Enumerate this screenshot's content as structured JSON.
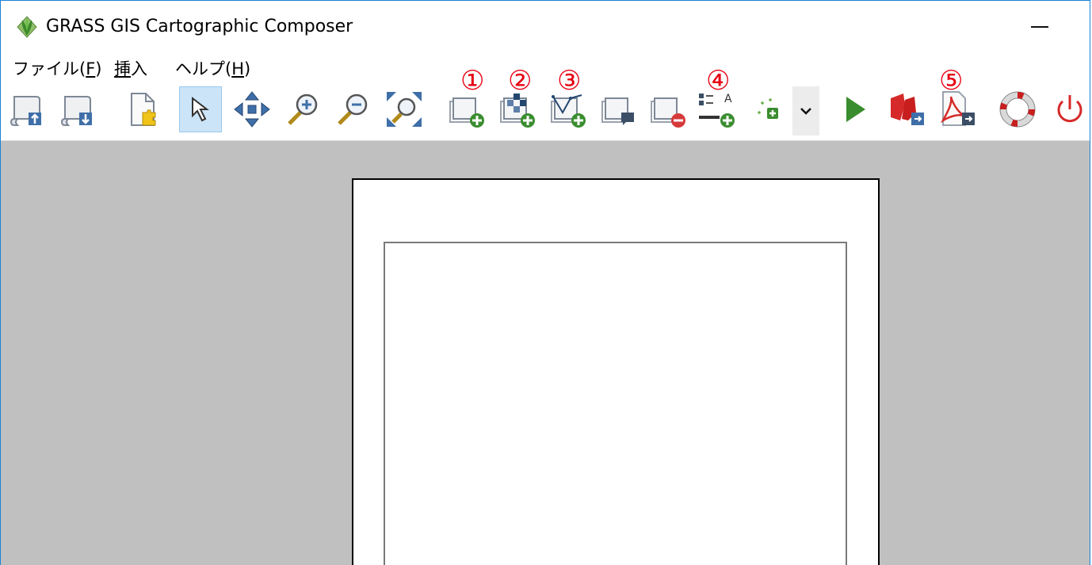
{
  "window": {
    "title": "GRASS GIS Cartographic Composer"
  },
  "menu": [
    {
      "label": "ファイル(F)",
      "mnemonic": "F"
    },
    {
      "label": "挿入",
      "mnemonic": "挿"
    },
    {
      "label": "ヘルプ(H)",
      "mnemonic": "H"
    }
  ],
  "toolbar": {
    "buttons": [
      {
        "icon": "load-instructions-icon"
      },
      {
        "icon": "save-instructions-icon"
      },
      {
        "icon": "page-setup-icon"
      },
      {
        "icon": "pointer-icon",
        "active": true
      },
      {
        "icon": "pan-icon"
      },
      {
        "icon": "zoom-in-icon"
      },
      {
        "icon": "zoom-out-icon"
      },
      {
        "icon": "zoom-all-icon"
      },
      {
        "icon": "add-map-icon"
      },
      {
        "icon": "add-raster-icon"
      },
      {
        "icon": "add-vector-icon"
      },
      {
        "icon": "add-overlay-icon"
      },
      {
        "icon": "delete-icon"
      },
      {
        "icon": "add-legend-icon"
      },
      {
        "icon": "add-point-icon"
      },
      {
        "icon": "dropdown-chevron-icon"
      },
      {
        "icon": "generate-icon"
      },
      {
        "icon": "export-ps-icon"
      },
      {
        "icon": "export-pdf-icon"
      },
      {
        "icon": "help-icon"
      },
      {
        "icon": "quit-icon"
      }
    ]
  },
  "annotations": {
    "m1": "①",
    "m2": "②",
    "m3": "③",
    "m4": "④",
    "m5": "⑤",
    "color": "#e60012"
  },
  "colors": {
    "canvas_bg": "#c0c0c0",
    "active_button_bg": "#cce4f7",
    "window_border": "#1883d7"
  }
}
